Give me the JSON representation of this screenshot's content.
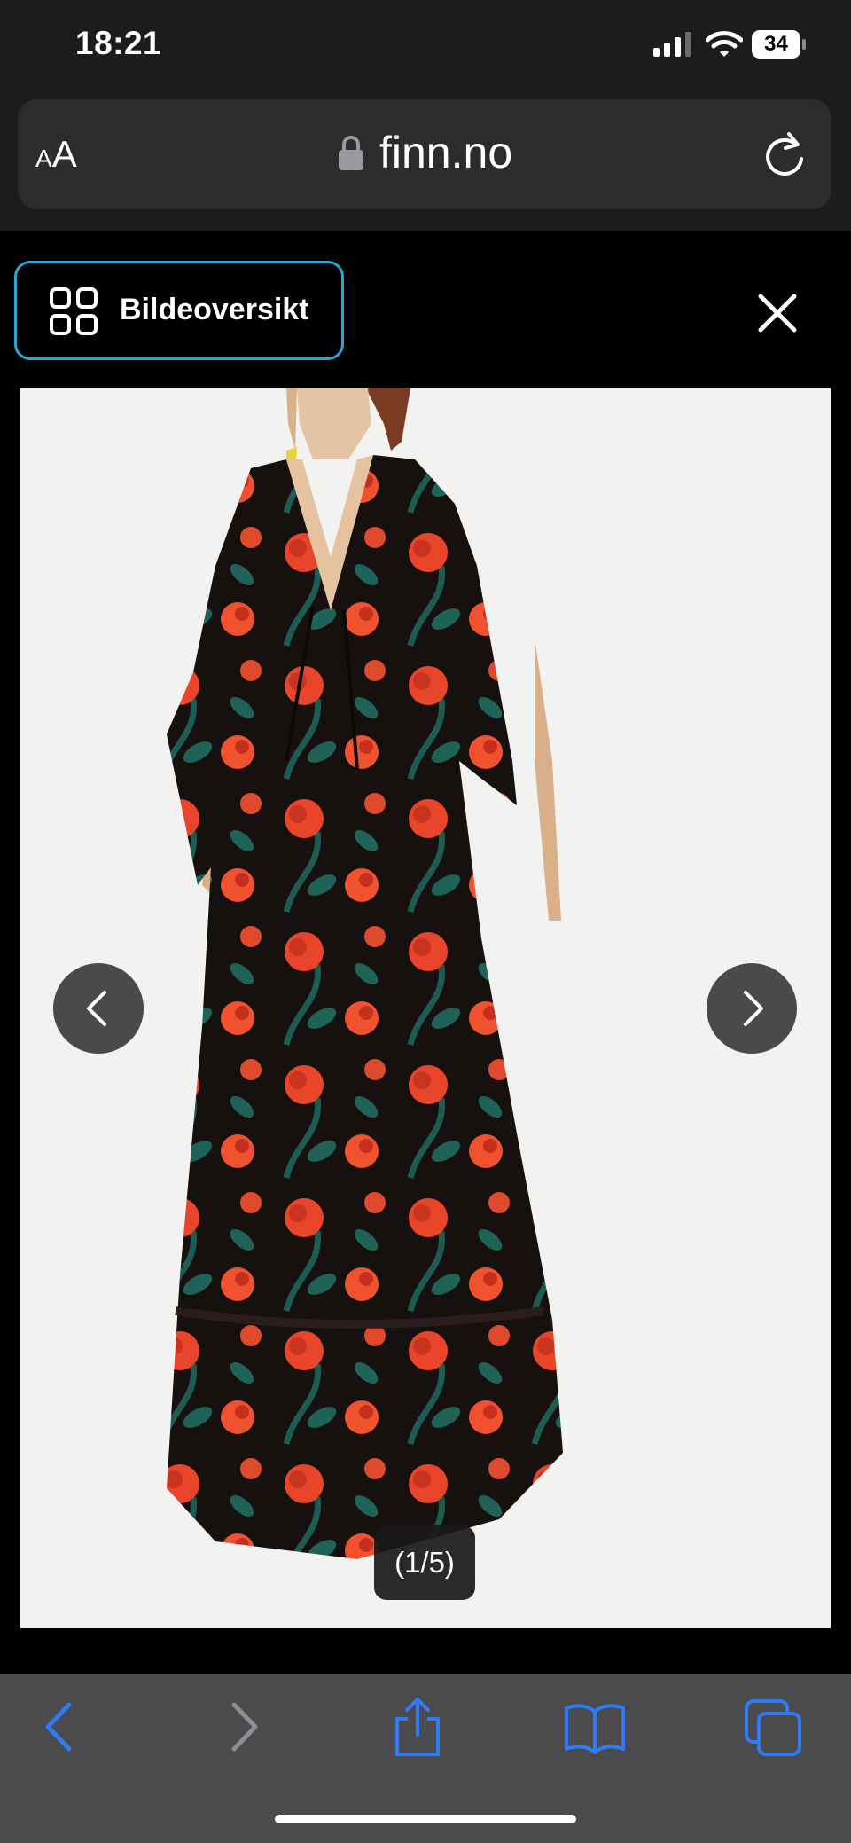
{
  "status_bar": {
    "time": "18:21",
    "battery_level": "34",
    "icons": [
      "cellular-signal-icon",
      "wifi-icon",
      "battery-icon"
    ]
  },
  "browser": {
    "reader_label_small": "A",
    "reader_label_large": "A",
    "url": "finn.no",
    "icons": [
      "lock-icon",
      "reload-icon"
    ]
  },
  "gallery": {
    "overview_label": "Bildeoversikt",
    "counter": "(1/5)",
    "icons": [
      "grid-icon",
      "close-icon",
      "chevron-left-icon",
      "chevron-right-icon"
    ],
    "accent_color": "#29a8d8"
  },
  "toolbar": {
    "icons": [
      "back-icon",
      "forward-icon",
      "share-icon",
      "bookmarks-icon",
      "tabs-icon"
    ],
    "active_color": "#2f7bf5",
    "disabled_color": "#8e8e93"
  }
}
